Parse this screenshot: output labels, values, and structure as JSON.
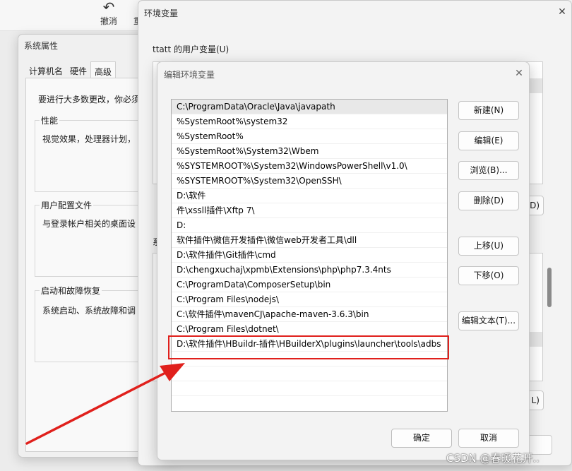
{
  "background_app": {
    "undo_label": "撤消",
    "clipped_label": "重"
  },
  "system_properties": {
    "title": "系统属性",
    "tabs": [
      "计算机名",
      "硬件",
      "高级"
    ],
    "intro": "要进行大多数更改，你必须",
    "performance": {
      "title": "性能",
      "text": "视觉效果，处理器计划，"
    },
    "user_profiles": {
      "title": "用户配置文件",
      "text": "与登录帐户相关的桌面设"
    },
    "startup_recovery": {
      "title": "启动和故障恢复",
      "text": "系统启动、系统故障和调"
    }
  },
  "env_vars": {
    "title": "环境变量",
    "user_section_title": "ttatt 的用户变量(U)",
    "system_section_title_clipped": "系",
    "user_delete_clipped": "D)",
    "system_delete_clipped": "L)"
  },
  "edit_dialog": {
    "title": "编辑环境变量",
    "paths": [
      "C:\\ProgramData\\Oracle\\Java\\javapath",
      "%SystemRoot%\\system32",
      "%SystemRoot%",
      "%SystemRoot%\\System32\\Wbem",
      "%SYSTEMROOT%\\System32\\WindowsPowerShell\\v1.0\\",
      "%SYSTEMROOT%\\System32\\OpenSSH\\",
      "D:\\软件",
      "件\\xssll插件\\Xftp 7\\",
      "D:",
      "软件插件\\微信开发插件\\微信web开发者工具\\dll",
      "D:\\软件插件\\Git插件\\cmd",
      "D:\\chengxuchaj\\xpmb\\Extensions\\php\\php7.3.4nts",
      "C:\\ProgramData\\ComposerSetup\\bin",
      "C:\\Program Files\\nodejs\\",
      "C:\\软件插件\\mavenCJ\\apache-maven-3.6.3\\bin",
      "C:\\Program Files\\dotnet\\",
      "D:\\软件插件\\HBuildr-插件\\HBuilderX\\plugins\\launcher\\tools\\adbs"
    ],
    "buttons": {
      "new": "新建(N)",
      "edit": "编辑(E)",
      "browse": "浏览(B)...",
      "delete": "删除(D)",
      "move_up": "上移(U)",
      "move_down": "下移(O)",
      "edit_text": "编辑文本(T)...",
      "ok": "确定",
      "cancel": "取消"
    }
  },
  "annotation": {
    "highlight_color": "#e0201c",
    "arrow_color": "#e0201c"
  },
  "watermark": "CSDN @春暖花开.."
}
